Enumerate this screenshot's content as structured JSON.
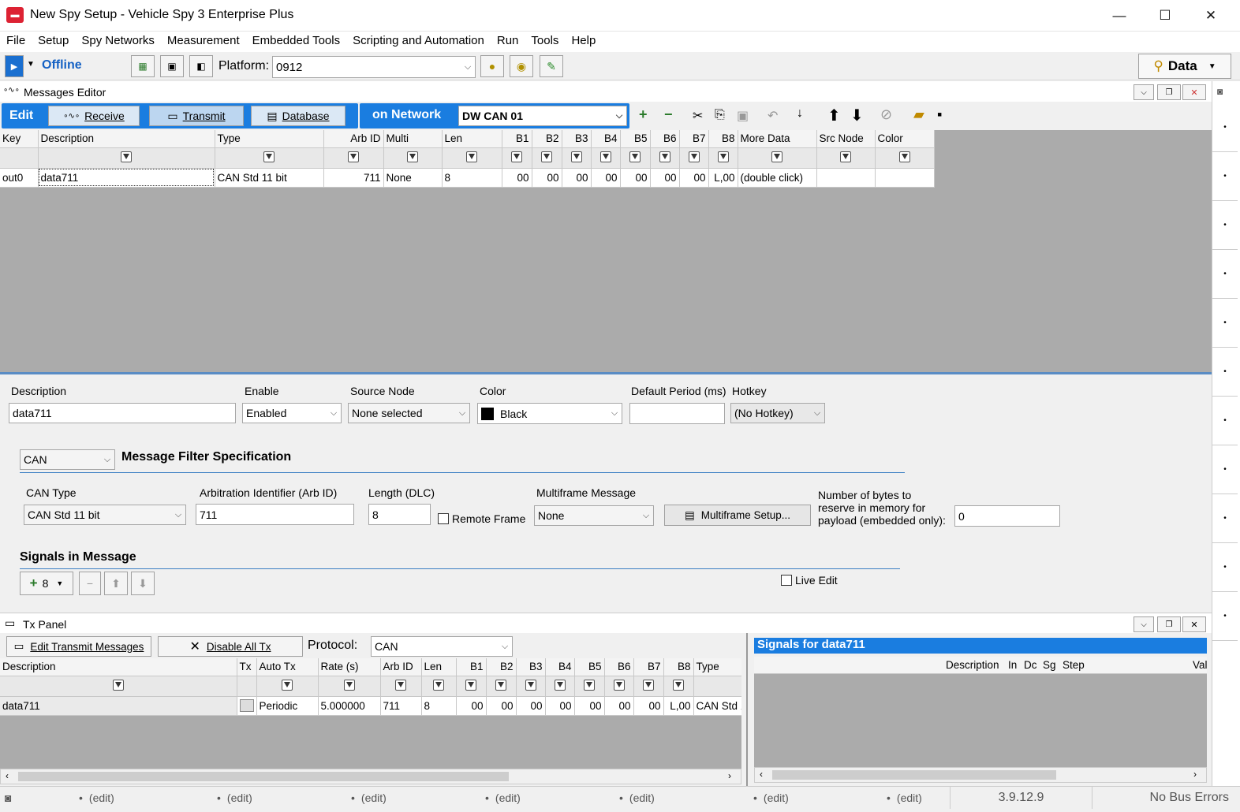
{
  "window": {
    "title": "New Spy Setup - Vehicle Spy 3 Enterprise Plus",
    "icon": "app-car-icon",
    "controls": {
      "minimize": "—",
      "maximize": "☐",
      "close": "✕"
    }
  },
  "menu": [
    "File",
    "Setup",
    "Spy Networks",
    "Measurement",
    "Embedded Tools",
    "Scripting and Automation",
    "Run",
    "Tools",
    "Help"
  ],
  "toolbar": {
    "status": "Offline",
    "platform_label": "Platform:",
    "platform_value": "0912",
    "data_button": "Data"
  },
  "messages_editor": {
    "title": "Messages Editor",
    "tabs": {
      "edit": "Edit",
      "receive": "Receive",
      "transmit": "Transmit",
      "database": "Database"
    },
    "network_label": "on Network",
    "network_value": "DW CAN 01",
    "columns": [
      "Key",
      "Description",
      "Type",
      "Arb ID",
      "Multi",
      "Len",
      "B1",
      "B2",
      "B3",
      "B4",
      "B5",
      "B6",
      "B7",
      "B8",
      "More Data",
      "Src Node",
      "Color"
    ],
    "row": {
      "key": "out0",
      "description": "data711",
      "type": "CAN Std 11 bit",
      "arb_id": "711",
      "multi": "None",
      "len": "8",
      "b1": "00",
      "b2": "00",
      "b3": "00",
      "b4": "00",
      "b5": "00",
      "b6": "00",
      "b7": "00",
      "b8": "L,00",
      "more_data": "(double click)",
      "src_node": "",
      "color": ""
    }
  },
  "properties": {
    "description_label": "Description",
    "description_value": "data711",
    "enable_label": "Enable",
    "enable_value": "Enabled",
    "source_node_label": "Source Node",
    "source_node_value": "None selected",
    "color_label": "Color",
    "color_value": "Black",
    "color_swatch": "#000000",
    "period_label": "Default Period (ms)",
    "period_value": "",
    "hotkey_label": "Hotkey",
    "hotkey_value": "(No Hotkey)",
    "protocol_value": "CAN",
    "filter_title": "Message Filter Specification",
    "can_type_label": "CAN Type",
    "can_type_value": "CAN Std 11 bit",
    "arb_label": "Arbitration Identifier (Arb ID)",
    "arb_value": "711",
    "length_label": "Length (DLC)",
    "length_value": "8",
    "remote_frame_label": "Remote Frame",
    "multiframe_label": "Multiframe Message",
    "multiframe_value": "None",
    "multiframe_setup": "Multiframe Setup...",
    "bytes_label_1": "Number of bytes to",
    "bytes_label_2": "reserve in memory for",
    "bytes_label_3": "payload (embedded only):",
    "bytes_value": "0",
    "signals_title": "Signals in Message",
    "signal_count": "8",
    "live_edit_label": "Live Edit"
  },
  "tx_panel": {
    "title": "Tx Panel",
    "edit_button": "Edit Transmit Messages",
    "disable_button": "Disable All Tx",
    "protocol_label": "Protocol:",
    "protocol_value": "CAN",
    "columns": [
      "Description",
      "Tx",
      "Auto Tx",
      "Rate (s)",
      "Arb ID",
      "Len",
      "B1",
      "B2",
      "B3",
      "B4",
      "B5",
      "B6",
      "B7",
      "B8",
      "Type"
    ],
    "row": {
      "description": "data711",
      "auto_tx": "Periodic",
      "rate": "5.000000",
      "arb_id": "711",
      "len": "8",
      "b1": "00",
      "b2": "00",
      "b3": "00",
      "b4": "00",
      "b5": "00",
      "b6": "00",
      "b7": "00",
      "b8": "L,00",
      "type": "CAN Std 11"
    }
  },
  "signals_panel": {
    "title": "Signals for data711",
    "columns": [
      "Description",
      "In",
      "Dc",
      "Sg",
      "Step",
      "Val"
    ]
  },
  "statusbar": {
    "edit_label": "(edit)",
    "version": "3.9.12.9",
    "bus_status": "No Bus Errors"
  }
}
